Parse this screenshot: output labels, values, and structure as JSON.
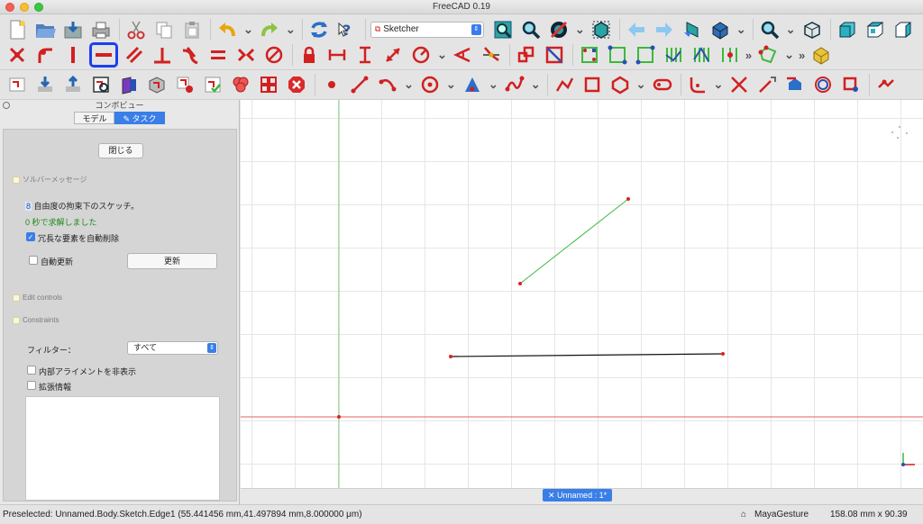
{
  "window": {
    "title": "FreeCAD 0.19"
  },
  "toolbar": {
    "workbench_value": "Sketcher",
    "row1_icons": [
      "new-file-icon",
      "open-file-icon",
      "save-icon",
      "print-icon",
      "cut-icon",
      "copy-icon",
      "paste-icon",
      "undo-icon",
      "redo-icon",
      "refresh-icon",
      "whats-this-icon"
    ],
    "row1_view_icons": [
      "fit-all-icon",
      "fit-selection-icon",
      "draw-style-icon",
      "bounding-box-icon",
      "back-icon",
      "forward-icon",
      "std-link-icon",
      "navigation-icon",
      "zoom-icon",
      "isometric-view-icon",
      "front-view-icon",
      "top-view-icon",
      "right-view-icon"
    ],
    "row2_icons": [
      "constrain-coincident-icon",
      "constrain-point-on-object-icon",
      "constrain-vertical-icon",
      "constrain-horizontal-icon",
      "constrain-parallel-icon",
      "constrain-perpendicular-icon",
      "constrain-tangent-icon",
      "constrain-equal-icon",
      "constrain-symmetric-icon",
      "constrain-block-icon",
      "constrain-lock-icon",
      "constrain-horizontal-distance-icon",
      "constrain-vertical-distance-icon",
      "constrain-distance-icon",
      "constrain-radius-icon",
      "constrain-angle-icon",
      "constrain-snell-icon",
      "toggle-driving-icon",
      "deactivate-constraint-icon",
      "select-constraints-icon",
      "select-origin-icon",
      "select-v-axis-icon",
      "select-h-axis-icon",
      "select-redundant-icon",
      "select-conflicting-icon",
      "more-icon",
      "validate-sketch-icon",
      "more-icon",
      "create-body-icon"
    ],
    "row3_icons": [
      "new-sketch-icon",
      "edit-sketch-icon",
      "leave-sketch-icon",
      "view-sketch-icon",
      "view-section-icon",
      "map-sketch-icon",
      "reorient-sketch-icon",
      "validate-icon",
      "merge-sketch-icon",
      "mirror-sketch-icon",
      "stop-operation-icon",
      "create-point-icon",
      "create-line-icon",
      "create-arc-icon",
      "create-circle-icon",
      "create-conic-icon",
      "create-bspline-icon",
      "create-polyline-icon",
      "create-rectangle-icon",
      "create-polygon-icon",
      "create-slot-icon",
      "create-fillet-icon",
      "trim-edge-icon",
      "extend-edge-icon",
      "external-geometry-icon",
      "carbon-copy-icon",
      "toggle-construction-icon"
    ]
  },
  "combo": {
    "title": "コンボビュー",
    "tab_model": "モデル",
    "tab_task": "タスク",
    "close_button": "閉じる",
    "solver_section": "ソルバーメッセージ",
    "dof_number": "8",
    "dof_text": "自由度の拘束下のスケッチ。",
    "solved_text": "0 秒で求解しました",
    "auto_remove_label": "冗長な要素を自動削除",
    "auto_remove_checked": true,
    "auto_update_label": "自動更新",
    "update_button": "更新",
    "edit_controls_section": "Edit controls",
    "constraints_section": "Constraints",
    "filter_label": "フィルター：",
    "filter_value": "すべて",
    "hide_internal_label": "内部アライメントを非表示",
    "extended_info_label": "拡張情報"
  },
  "document_tab": {
    "label": "Unnamed : 1*"
  },
  "status": {
    "preselected": "Preselected: Unnamed.Body.Sketch.Edge1 (55.441456 mm,41.497894 mm,8.000000 μm)",
    "nav_style": "MayaGesture",
    "dimensions": "158.08 mm x 90.39 mm"
  },
  "colors": {
    "accent": "#3a7ee8",
    "highlight_border": "#1b3ff0",
    "constraint_red": "#d22020",
    "x_axis": "#e06060",
    "y_axis": "#7ccf7c",
    "construction_green": "#3cb93c"
  }
}
